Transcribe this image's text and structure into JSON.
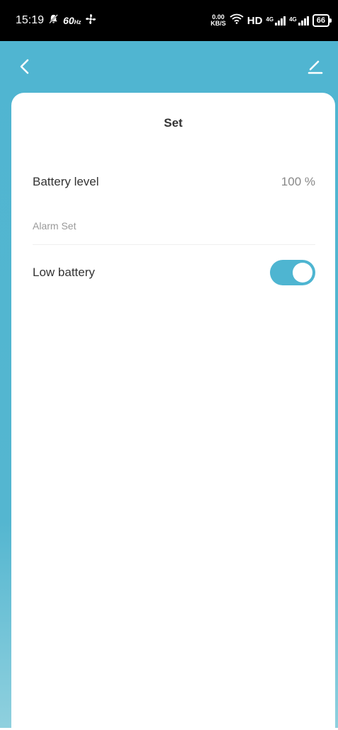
{
  "status_bar": {
    "time": "15:19",
    "refresh_rate": "60",
    "refresh_unit": "Hz",
    "network_speed_value": "0.00",
    "network_speed_unit": "KB/S",
    "hd_label": "HD",
    "signal1_label": "4G",
    "signal2_label": "4G",
    "battery": "66"
  },
  "header": {
    "back_icon": "chevron-left-icon",
    "edit_icon": "pencil-icon"
  },
  "card": {
    "title": "Set",
    "battery_level": {
      "label": "Battery level",
      "value": "100 %"
    },
    "alarm_section": {
      "label": "Alarm Set"
    },
    "low_battery": {
      "label": "Low battery",
      "enabled": true
    }
  },
  "colors": {
    "accent": "#4eb5d1",
    "header_bg": "#50b5d1",
    "text_primary": "#333333",
    "text_secondary": "#888888"
  }
}
